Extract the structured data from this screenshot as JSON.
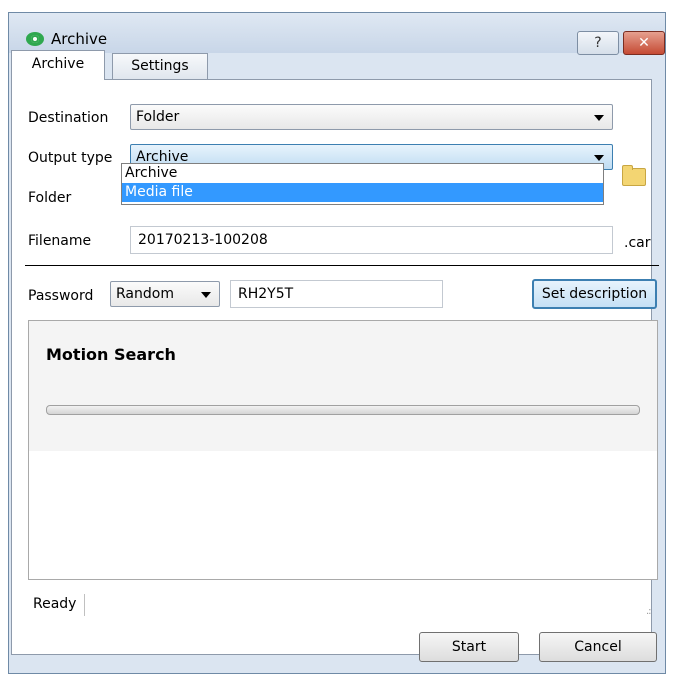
{
  "window": {
    "title": "Archive",
    "help_glyph": "?",
    "close_glyph": "✕"
  },
  "tabs": [
    "Archive",
    "Settings"
  ],
  "form": {
    "destination_label": "Destination",
    "destination_value": "Folder",
    "output_type_label": "Output type",
    "output_type_value": "Archive",
    "output_type_options": [
      "Archive",
      "Media file"
    ],
    "output_type_highlighted": "Media file",
    "folder_label": "Folder",
    "filename_label": "Filename",
    "filename_value": "20170213-100208",
    "filename_extension": ".car",
    "password_label": "Password",
    "password_mode": "Random",
    "password_value": "RH2Y5T",
    "set_description_label": "Set description"
  },
  "task": {
    "title": "Motion Search",
    "progress": 0
  },
  "status": {
    "text": "Ready"
  },
  "buttons": {
    "start": "Start",
    "cancel": "Cancel"
  },
  "icons": {
    "app": "archive-eye-icon",
    "folder": "folder-icon",
    "grip": "resize-grip-icon"
  },
  "colors": {
    "selection": "#3399ff",
    "close": "#c54a34",
    "focus": "#3c7fb1"
  }
}
